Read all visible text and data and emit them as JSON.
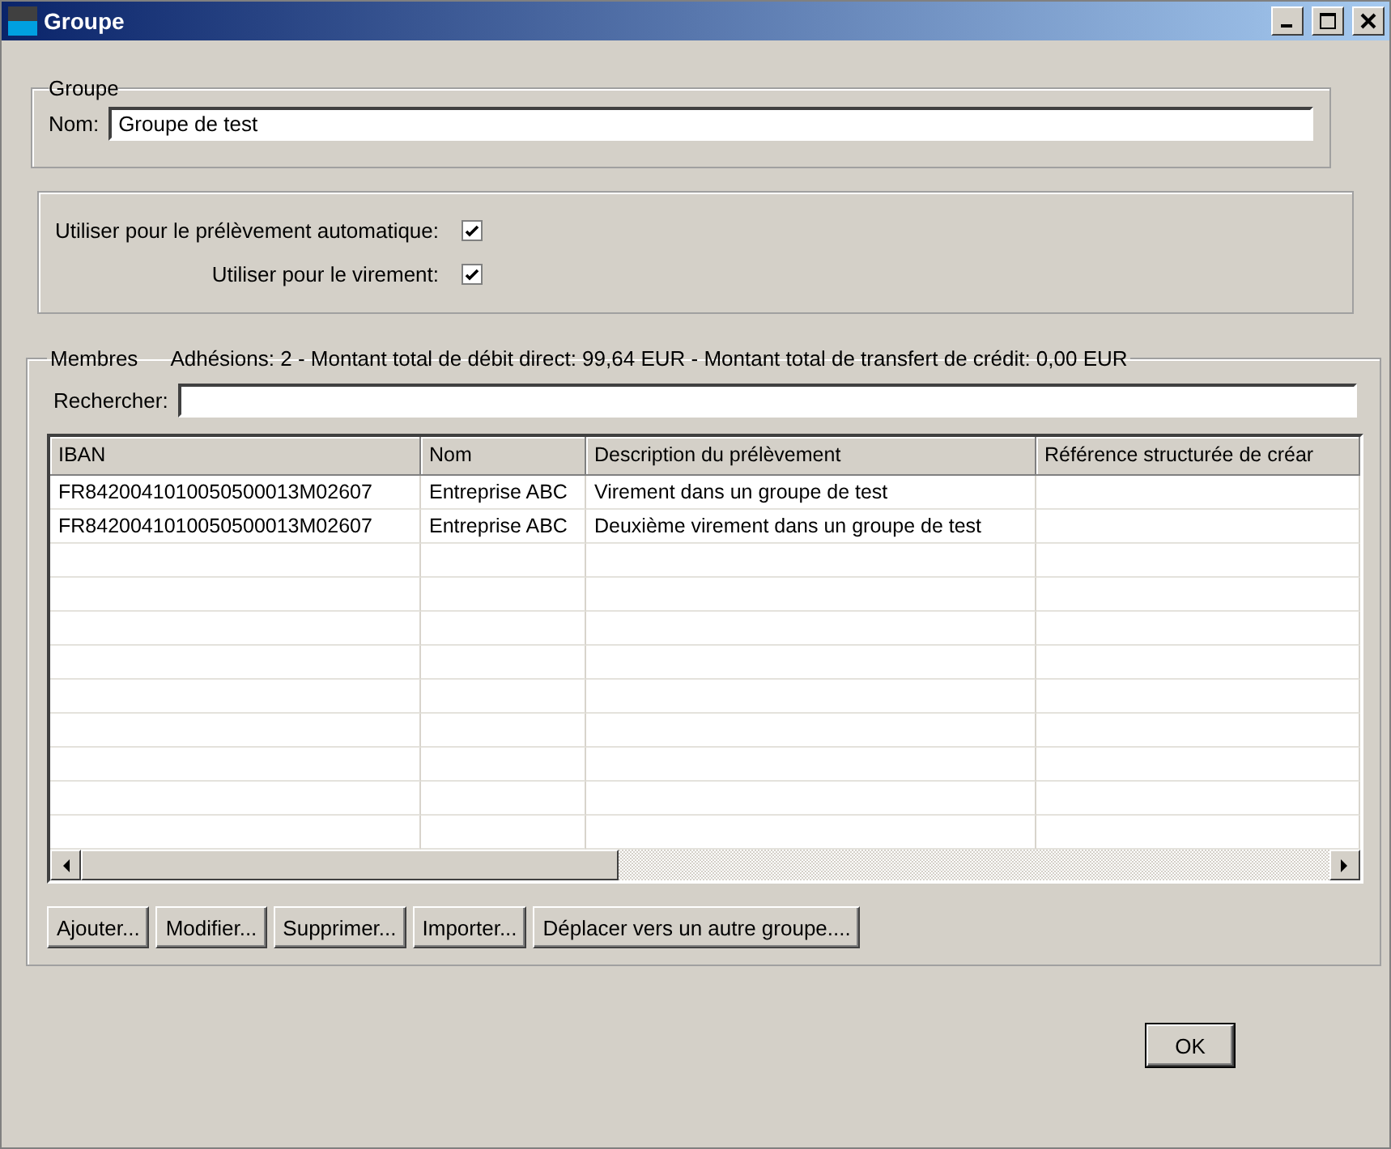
{
  "window": {
    "title": "Groupe"
  },
  "group": {
    "legend": "Groupe",
    "name_label": "Nom:",
    "name_value": "Groupe de test"
  },
  "options": [
    {
      "label": "Utiliser pour le prélèvement automatique:",
      "checked": true
    },
    {
      "label": "Utiliser pour le virement:",
      "checked": true
    }
  ],
  "members": {
    "legend": "Membres",
    "summary": "Adhésions: 2 - Montant total de débit direct: 99,64 EUR - Montant total de transfert de crédit: 0,00 EUR",
    "search_label": "Rechercher:",
    "table": {
      "columns": [
        "IBAN",
        "Nom",
        "Description du prélèvement",
        "Référence structurée de créar"
      ],
      "rows": [
        [
          "FR8420041010050500013M02607",
          "Entreprise ABC",
          "Virement dans un groupe de test",
          ""
        ],
        [
          "FR8420041010050500013M02607",
          "Entreprise ABC",
          "Deuxième virement dans un groupe de test",
          ""
        ]
      ]
    },
    "buttons": [
      "Ajouter...",
      "Modifier...",
      "Supprimer...",
      "Importer...",
      "Déplacer vers un autre groupe...."
    ]
  },
  "ok_button": "OK"
}
